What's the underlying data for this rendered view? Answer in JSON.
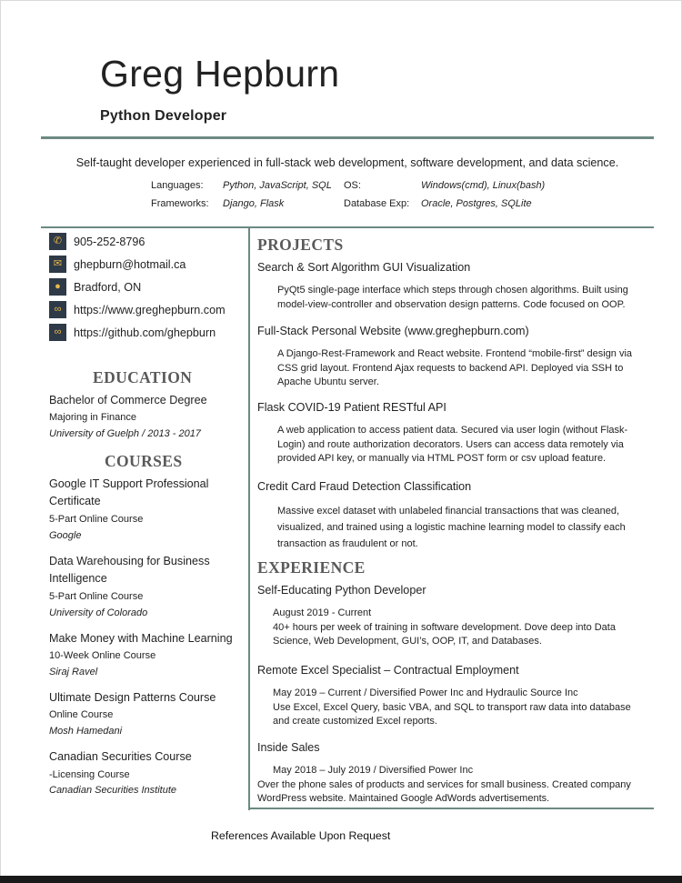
{
  "header": {
    "name": "Greg Hepburn",
    "role": "Python Developer",
    "summary": "Self-taught developer experienced in full-stack web development, software development, and data science.",
    "skills": {
      "languages_label": "Languages:",
      "languages": "Python, JavaScript, SQL",
      "os_label": "OS:",
      "os": "Windows(cmd), Linux(bash)",
      "frameworks_label": "Frameworks:",
      "frameworks": "Django, Flask",
      "database_label": "Database Exp:",
      "database": "Oracle, Postgres, SQLite"
    }
  },
  "contact": [
    {
      "icon": "phone-icon",
      "text": "905-252-8796"
    },
    {
      "icon": "envelope-icon",
      "text": "ghepburn@hotmail.ca"
    },
    {
      "icon": "location-pin-icon",
      "text": "Bradford, ON"
    },
    {
      "icon": "link-icon",
      "text": "https://www.greghepburn.com"
    },
    {
      "icon": "link-icon",
      "text": "https://github.com/ghepburn"
    }
  ],
  "education": {
    "heading": "EDUCATION",
    "degree": "Bachelor of Commerce Degree",
    "major": "Majoring in Finance",
    "school": "University of Guelph /  2013 - 2017"
  },
  "courses": {
    "heading": "COURSES",
    "items": [
      {
        "title_lines": [
          "Google IT Support Professional",
          "Certificate"
        ],
        "detail": "5-Part Online Course",
        "provider": "Google"
      },
      {
        "title_lines": [
          "Data Warehousing for Business",
          "Intelligence"
        ],
        "detail": "5-Part Online Course",
        "provider": "University of Colorado"
      },
      {
        "title_lines": [
          "Make Money with Machine Learning"
        ],
        "detail": "10-Week Online Course",
        "provider": "Siraj Ravel"
      },
      {
        "title_lines": [
          "Ultimate Design Patterns Course"
        ],
        "detail": "Online Course",
        "provider": "Mosh Hamedani"
      },
      {
        "title_lines": [
          "Canadian Securities Course"
        ],
        "detail": "-Licensing Course",
        "provider": "Canadian Securities Institute"
      }
    ]
  },
  "projects": {
    "heading": "PROJECTS",
    "items": [
      {
        "title": "Search & Sort Algorithm GUI Visualization",
        "lines": [
          "PyQt5 single-page interface which steps through chosen algorithms. Built using",
          "model-view-controller and observation design patterns. Code focused on OOP."
        ]
      },
      {
        "title": "Full-Stack Personal Website (www.greghepburn.com)",
        "lines": [
          "A Django-Rest-Framework and React website. Frontend “mobile-first” design via",
          "CSS grid layout. Frontend Ajax requests to backend API. Deployed via SSH to",
          "Apache Ubuntu server."
        ]
      },
      {
        "title": "Flask COVID-19 Patient RESTful API",
        "lines": [
          "A web application to access patient data.  Secured via user login (without Flask-",
          "Login) and route authorization decorators. Users can access data remotely via",
          "provided API key, or manually via HTML POST form or csv upload feature."
        ]
      },
      {
        "title": "Credit Card Fraud Detection Classification",
        "lines": [
          "Massive excel dataset with unlabeled financial transactions that was cleaned,",
          "visualized, and trained using a logistic machine learning model to classify each",
          "transaction as fraudulent or not."
        ]
      }
    ]
  },
  "experience": {
    "heading": "EXPERIENCE",
    "items": [
      {
        "title": "Self-Educating Python Developer",
        "lines": [
          "August 2019 - Current",
          "40+ hours per week of training in software development. Dove deep into Data",
          "Science, Web Development, GUI’s, OOP, IT, and Databases."
        ]
      },
      {
        "title": "Remote Excel Specialist – Contractual Employment",
        "lines": [
          "May 2019 – Current  /  Diversified Power Inc and Hydraulic Source Inc",
          "Use Excel, Excel Query, basic VBA, and SQL to transport raw data into database",
          "and create customized Excel reports."
        ]
      },
      {
        "title": "Inside Sales",
        "lines": [
          "May 2018 – July 2019  /  Diversified Power Inc",
          "Over the phone sales of products and services for small business.  Created company",
          "WordPress website. Maintained Google AdWords advertisements."
        ]
      }
    ]
  },
  "footer": {
    "references": "References Available Upon Request"
  }
}
